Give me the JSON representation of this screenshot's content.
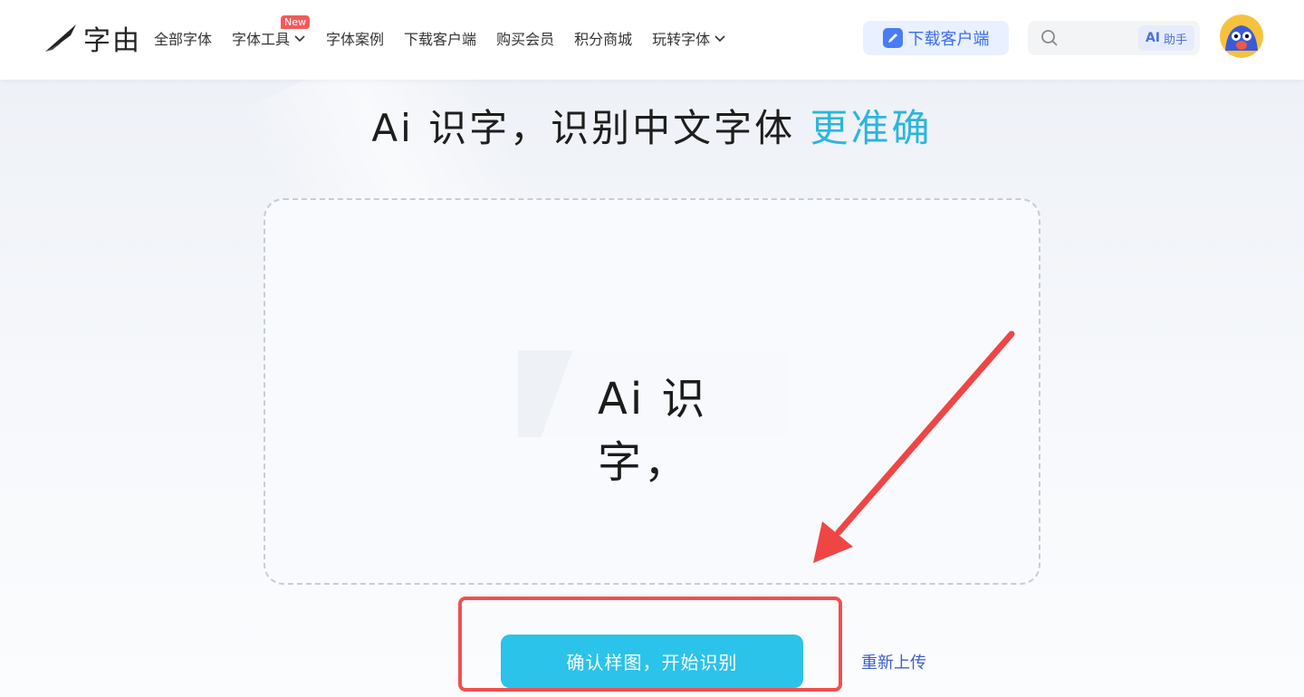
{
  "header": {
    "logo_text": "字由",
    "nav": [
      {
        "label": "全部字体",
        "dropdown": false,
        "badge": ""
      },
      {
        "label": "字体工具",
        "dropdown": true,
        "badge": "New"
      },
      {
        "label": "字体案例",
        "dropdown": false,
        "badge": ""
      },
      {
        "label": "下载客户端",
        "dropdown": false,
        "badge": ""
      },
      {
        "label": "购买会员",
        "dropdown": false,
        "badge": ""
      },
      {
        "label": "积分商城",
        "dropdown": false,
        "badge": ""
      },
      {
        "label": "玩转字体",
        "dropdown": true,
        "badge": ""
      }
    ],
    "download_button": "下载客户端",
    "search": {
      "placeholder": "",
      "ai_chip_prefix": "AI",
      "ai_chip_label": "助手"
    }
  },
  "main": {
    "title_main": "Ai 识字，识别中文字体",
    "title_accent": "更准确",
    "sample_text": "Ai 识字，",
    "confirm_button": "确认样图，开始识别",
    "reupload_link": "重新上传"
  },
  "colors": {
    "accent": "#2bb6dc",
    "button": "#2bc3ea",
    "annotation": "#f05050",
    "link": "#3d5fc9"
  },
  "icons": [
    "logo-brush-icon",
    "chevron-down-icon",
    "pen-icon",
    "search-icon",
    "avatar-bird-icon",
    "red-arrow-annotation"
  ]
}
